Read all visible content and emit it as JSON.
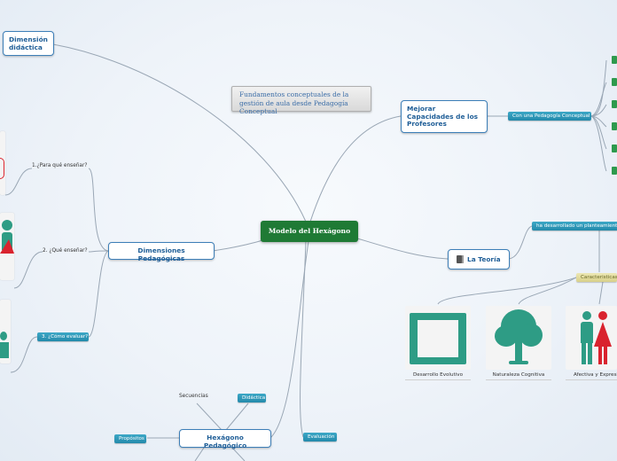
{
  "center": {
    "label": "Modelo del Hexágono"
  },
  "note": {
    "text": "Fundamentos conceptuales de la gestión de aula desde Pedagogía Conceptual"
  },
  "nodes": {
    "dimension_didactica": "Dimensión didáctica",
    "mejorar": "Mejorar Capacidades de los Profesores",
    "dimensiones": "Dimensiones Pedagógicas",
    "teoria": "La Teoría",
    "hexagono": "Hexágono Pedagógico"
  },
  "tags": {
    "pedagogia_conceptual": "Con una Pedagogía Conceptual",
    "planteamiento": "ha desarrollado un planteamiento",
    "caracteristicas": "Caracteristicas",
    "como_evaluar": "3. ¿Cómo evaluar?",
    "didactica": "Didáctica",
    "evaluacion": "Evaluación",
    "propositos": "Propósitos"
  },
  "plain_labels": {
    "para_que": "1.¿Para qué enseñar?",
    "que_ensenar": "2. ¿Qué enseñar?",
    "secuencias": "Secuencias"
  },
  "images": [
    {
      "caption": "Desarrollo Evolutivo",
      "icon": "monitor-icon"
    },
    {
      "caption": "Naturaleza Cognitiva",
      "icon": "tree-icon"
    },
    {
      "caption": "Afectiva y Expresiva",
      "icon": "people-icon"
    }
  ],
  "colors": {
    "center_bg": "#1f7a35",
    "node_border": "#3d7fb8",
    "node_text": "#1f5e97",
    "tag_bg": "#248aab",
    "icon_teal": "#2e9c85",
    "person_red": "#d9232e",
    "link": "#9aa7b5"
  }
}
